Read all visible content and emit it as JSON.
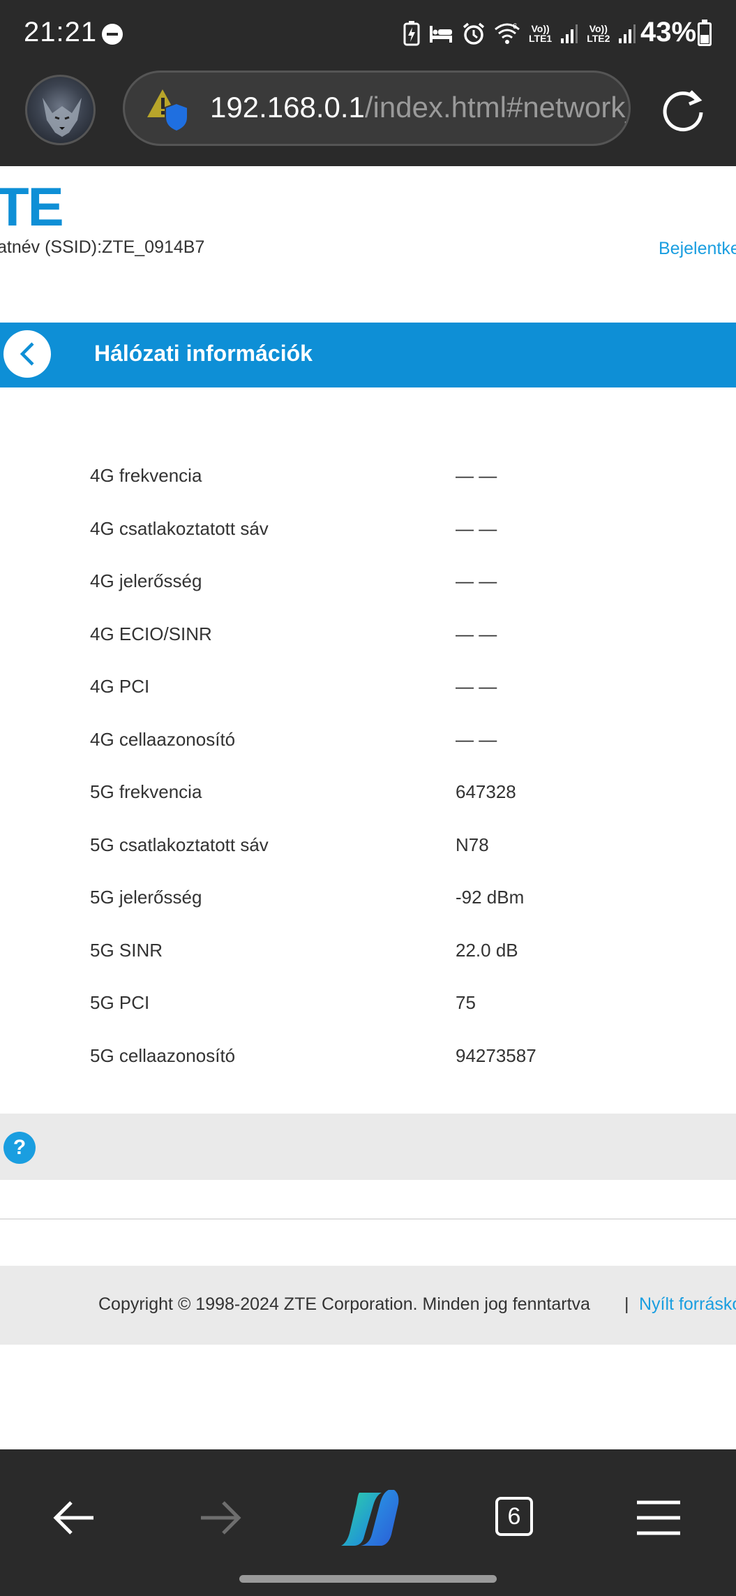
{
  "status_bar": {
    "time": "21:21",
    "battery_percent": "43%",
    "sim1_label": "LTE1",
    "sim2_label": "LTE2",
    "volte_label": "Vo))"
  },
  "browser": {
    "url_host": "192.168.0.1",
    "url_path": "/index.html#network_info",
    "tab_count": "6"
  },
  "header": {
    "logo_text": "TE",
    "ssid_text": "atnév (SSID):ZTE_0914B7",
    "login_link": "Bejelentkezés"
  },
  "title_bar": {
    "title": "Hálózati információk"
  },
  "network_info": {
    "rows": [
      {
        "label": "4G frekvencia",
        "value": "— —"
      },
      {
        "label": "4G csatlakoztatott sáv",
        "value": "— —"
      },
      {
        "label": "4G jelerősség",
        "value": "— —"
      },
      {
        "label": "4G ECIO/SINR",
        "value": "— —"
      },
      {
        "label": "4G PCI",
        "value": "— —"
      },
      {
        "label": "4G cellaazonosító",
        "value": "— —"
      },
      {
        "label": "5G frekvencia",
        "value": "647328"
      },
      {
        "label": "5G csatlakoztatott sáv",
        "value": "N78"
      },
      {
        "label": "5G jelerősség",
        "value": "-92 dBm"
      },
      {
        "label": "5G SINR",
        "value": "22.0 dB"
      },
      {
        "label": "5G PCI",
        "value": "75"
      },
      {
        "label": "5G cellaazonosító",
        "value": "94273587"
      }
    ]
  },
  "help": {
    "icon_glyph": "?"
  },
  "footer": {
    "copyright": "Copyright © 1998-2024 ZTE Corporation. Minden jog fenntartva",
    "separator": "|",
    "open_source_link": "Nyílt forráskódú licencek"
  },
  "colors": {
    "brand_blue": "#0e8fd6",
    "link_blue": "#1a9ee0",
    "chrome_dark": "#2a2a2a"
  },
  "icons": {
    "status": [
      "dnd-icon",
      "battery-saver-icon",
      "sleep-icon",
      "alarm-icon",
      "wifi-icon",
      "signal-icon",
      "signal-icon",
      "battery-icon"
    ],
    "browser": [
      "security-warning-icon",
      "reload-icon",
      "back-arrow-icon",
      "forward-arrow-icon",
      "copilot-icon",
      "tabs-icon",
      "menu-icon"
    ]
  }
}
